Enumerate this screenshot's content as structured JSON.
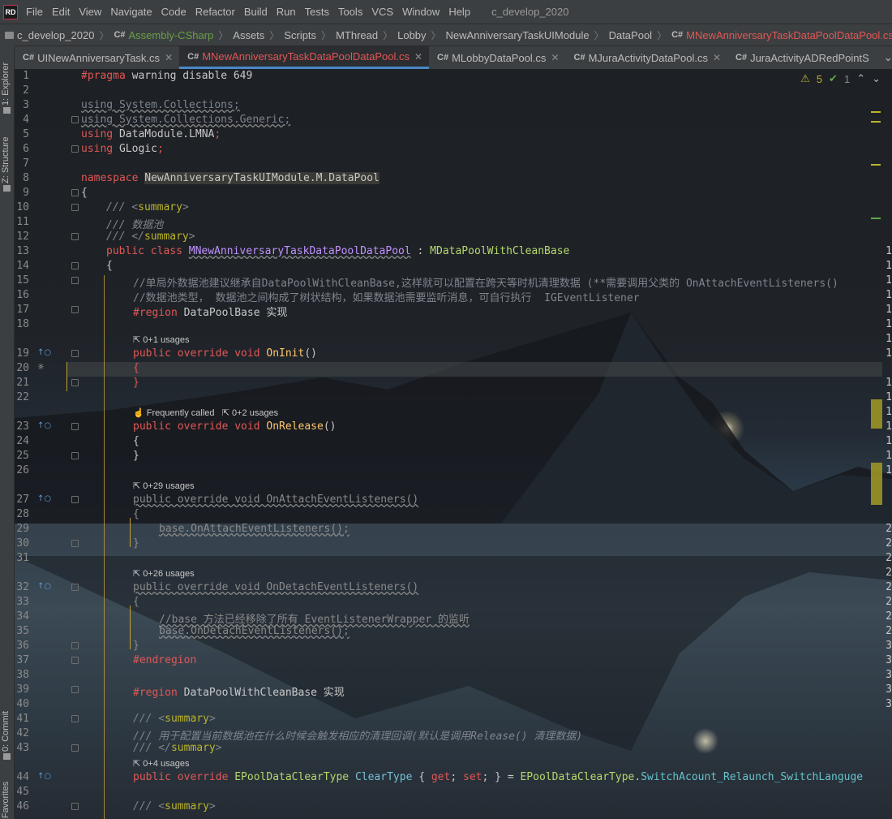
{
  "app": {
    "logo_text": "RD",
    "menu": [
      "File",
      "Edit",
      "View",
      "Navigate",
      "Code",
      "Refactor",
      "Build",
      "Run",
      "Tests",
      "Tools",
      "VCS",
      "Window",
      "Help"
    ],
    "window_title": "c_develop_2020"
  },
  "breadcrumb": {
    "items": [
      "c_develop_2020",
      "Assembly-CSharp",
      "Assets",
      "Scripts",
      "MThread",
      "Lobby",
      "NewAnniversaryTaskUIModule",
      "DataPool",
      "MNewAnniversaryTaskDataPoolDataPool.cs"
    ],
    "cs_tag": "C#"
  },
  "tabs": [
    {
      "label": "UINewAnniversaryTask.cs",
      "active": false
    },
    {
      "label": "MNewAnniversaryTaskDataPoolDataPool.cs",
      "active": true
    },
    {
      "label": "MLobbyDataPool.cs",
      "active": false
    },
    {
      "label": "MJuraActivityDataPool.cs",
      "active": false
    },
    {
      "label": "JuraActivityADRedPointS",
      "active": false
    }
  ],
  "tool_windows": {
    "explorer": "1: Explorer",
    "structure": "Z: Structure",
    "commit": "0: Commit",
    "favorites": "Favorites"
  },
  "inspections": {
    "warnings": "5",
    "ok": "1"
  },
  "hints": {
    "h19": "0+1 usages",
    "h23a": "Frequently called",
    "h23b": "0+2 usages",
    "h27": "0+29 usages",
    "h32": "0+26 usages",
    "h44": "0+4 usages"
  },
  "code": {
    "l1a": "#pragma",
    "l1b": " warning disable 649",
    "l3": "using System.Collections;",
    "l4": "using System.Collections.Generic;",
    "l5a": "using",
    "l5b": " DataModule.LMNA",
    "l5c": ";",
    "l6a": "using",
    "l6b": " GLogic",
    "l6c": ";",
    "l8a": "namespace",
    "l8b": "NewAnniversaryTaskUIModule.M.DataPool",
    "l9": "{",
    "l10a": "/// <",
    "l10b": "summary",
    "l10c": ">",
    "l11": "/// 数据池",
    "l12a": "/// </",
    "l12b": "summary",
    "l12c": ">",
    "l13a": "public class",
    "l13b": "MNewAnniversaryTaskDataPoolDataPool",
    "l13c": " : ",
    "l13d": "MDataPoolWithCleanBase",
    "l14": "{",
    "l15": "//单局外数据池建议继承自DataPoolWithCleanBase,这样就可以配置在跨天等时机清理数据 (**需要调用父类的 OnAttachEventListeners()",
    "l16": "//数据池类型， 数据池之间构成了树状结构，如果数据池需要监听消息，可自行执行  IGEventListener",
    "l17a": "#region",
    "l17b": " DataPoolBase 实现",
    "l19a": "public override void",
    "l19b": "OnInit",
    "l19c": "()",
    "l20": "{",
    "l21": "}",
    "l23a": "public override void",
    "l23b": "OnRelease",
    "l23c": "()",
    "l24": "{",
    "l25": "}",
    "l27": "public override void OnAttachEventListeners()",
    "l28": "{",
    "l29": "base.OnAttachEventListeners();",
    "l30": "}",
    "l32": "public override void OnDetachEventListeners()",
    "l33": "{",
    "l34": "//base 方法已经移除了所有 EventListenerWrapper 的监听",
    "l35": "base.OnDetachEventListeners();",
    "l36": "}",
    "l37": "#endregion",
    "l39a": "#region",
    "l39b": " DataPoolWithCleanBase 实现",
    "l41a": "/// <",
    "l41b": "summary",
    "l41c": ">",
    "l42": "/// 用于配置当前数据池在什么时候会触发相应的清理回调(默认是调用Release() 清理数据)",
    "l43a": "/// </",
    "l43b": "summary",
    "l43c": ">",
    "l44a": "public override",
    "l44b": "EPoolDataClearType",
    "l44c": "ClearType",
    "l44d": "{ ",
    "l44e": "get",
    "l44f": "; ",
    "l44g": "set",
    "l44h": "; } = ",
    "l44i": "EPoolDataClearType",
    "l44j": ".",
    "l44k": "SwitchAcount_Relaunch_SwitchLanguge",
    "l46a": "/// <",
    "l46b": "summary",
    "l46c": ">"
  },
  "line_numbers": [
    "1",
    "2",
    "3",
    "4",
    "5",
    "6",
    "7",
    "8",
    "9",
    "10",
    "11",
    "12",
    "13",
    "14",
    "15",
    "16",
    "17",
    "18",
    "19",
    "20",
    "21",
    "22",
    "23",
    "24",
    "25",
    "26",
    "27",
    "28",
    "29",
    "30",
    "31",
    "32",
    "33",
    "34",
    "35",
    "36",
    "37",
    "38",
    "39",
    "40",
    "41",
    "42",
    "43",
    "44",
    "45",
    "46"
  ],
  "right_numbers": [
    "1",
    "1",
    "1",
    "1",
    "1",
    "1",
    "1",
    "1",
    "1",
    "1",
    "1",
    "1",
    "1",
    "1",
    "1",
    "2",
    "2",
    "2",
    "2",
    "2",
    "2",
    "2",
    "2",
    "3",
    "3",
    "3",
    "3",
    "3",
    "3",
    "3",
    "3",
    "3",
    "3",
    "4"
  ],
  "colors": {
    "accent": "#4a88c7",
    "keyword": "#e15755",
    "warning": "#bbb529"
  }
}
